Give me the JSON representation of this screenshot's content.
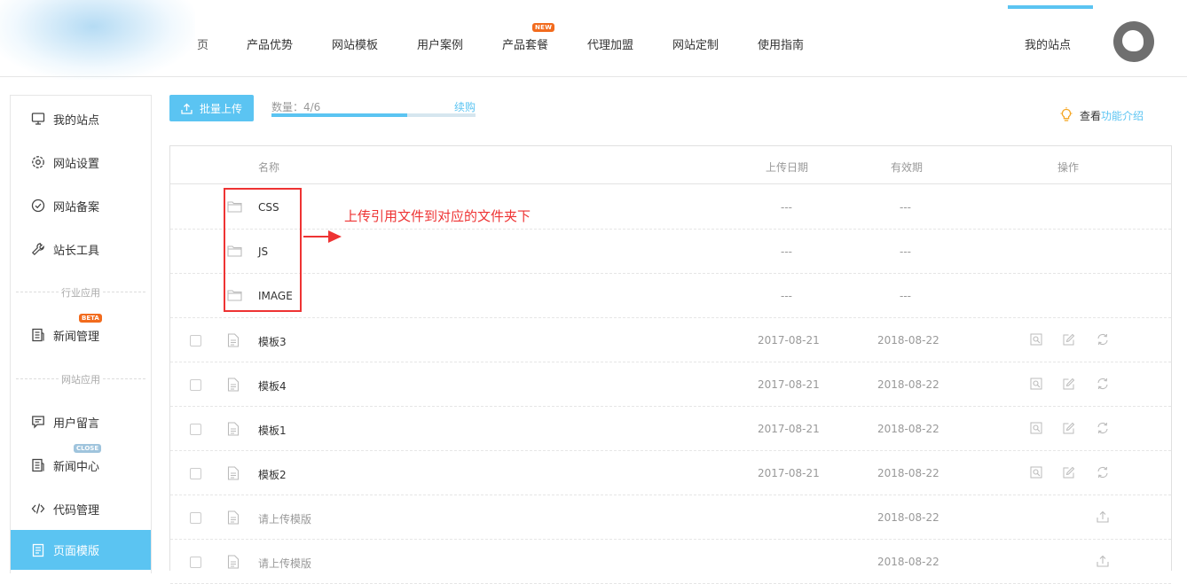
{
  "nav": {
    "partial_item": "页",
    "items": [
      "产品优势",
      "网站模板",
      "用户案例",
      "产品套餐",
      "代理加盟",
      "网站定制",
      "使用指南"
    ],
    "new_badge": "NEW",
    "my_site": "我的站点"
  },
  "sidebar": {
    "items": [
      {
        "label": "我的站点",
        "icon": "monitor-icon"
      },
      {
        "label": "网站设置",
        "icon": "gear-icon"
      },
      {
        "label": "网站备案",
        "icon": "check-circle-icon"
      },
      {
        "label": "站长工具",
        "icon": "wrench-icon"
      },
      {
        "label": "新闻管理",
        "icon": "news-icon"
      },
      {
        "label": "用户留言",
        "icon": "message-icon"
      },
      {
        "label": "新闻中心",
        "icon": "news-icon"
      },
      {
        "label": "代码管理",
        "icon": "code-icon"
      },
      {
        "label": "页面模版",
        "icon": "page-icon"
      }
    ],
    "divider_industry": "行业应用",
    "divider_site": "网站应用",
    "beta_badge": "BETA",
    "close_badge": "CLOSE",
    "active_index": 8
  },
  "toolbar": {
    "upload_label": "批量上传",
    "quota_label": "数量：4/6",
    "quota_fraction": 0.667,
    "renew_label": "续购",
    "view_label": "查看",
    "feature_link": "功能介绍"
  },
  "table": {
    "headers": {
      "name": "名称",
      "upload_date": "上传日期",
      "expiry": "有效期",
      "actions": "操作"
    },
    "folders": [
      {
        "name": "CSS",
        "upload_date": "---",
        "expiry": "---"
      },
      {
        "name": "JS",
        "upload_date": "---",
        "expiry": "---"
      },
      {
        "name": "IMAGE",
        "upload_date": "---",
        "expiry": "---"
      }
    ],
    "files": [
      {
        "name": "模板3",
        "upload_date": "2017-08-21",
        "expiry": "2018-08-22"
      },
      {
        "name": "模板4",
        "upload_date": "2017-08-21",
        "expiry": "2018-08-22"
      },
      {
        "name": "模板1",
        "upload_date": "2017-08-21",
        "expiry": "2018-08-22"
      },
      {
        "name": "模板2",
        "upload_date": "2017-08-21",
        "expiry": "2018-08-22"
      }
    ],
    "pending": [
      {
        "name": "请上传模版",
        "expiry": "2018-08-22"
      },
      {
        "name": "请上传模版",
        "expiry": "2018-08-22"
      }
    ]
  },
  "annotation": {
    "text": "上传引用文件到对应的文件夹下",
    "color": "#ee3333"
  },
  "colors": {
    "accent": "#5bc4f2",
    "badge_new": "#f26b1d",
    "badge_close": "#9fc4dd"
  }
}
